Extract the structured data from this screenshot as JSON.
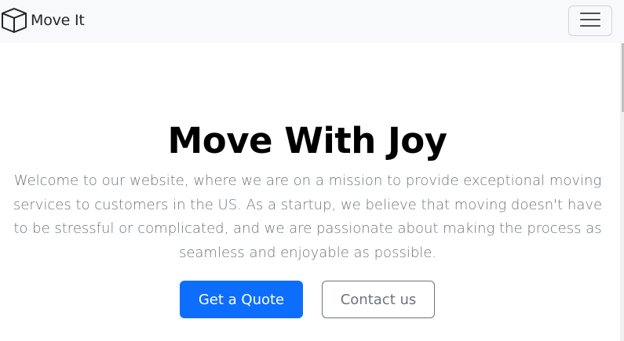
{
  "navbar": {
    "brand_name": "Move It",
    "brand_icon": "box-icon",
    "toggler_icon": "hamburger-menu-icon"
  },
  "hero": {
    "title": "Move With Joy",
    "description": "Welcome to our website, where we are on a mission to provide exceptional moving services to customers in the US. As a startup, we believe that moving doesn't have to be stressful or complicated, and we are passionate about making the process as seamless and enjoyable as possible.",
    "primary_button": "Get a Quote",
    "secondary_button": "Contact us"
  },
  "colors": {
    "navbar_bg": "#f8f9fa",
    "primary": "#0d6efd",
    "secondary_text": "#6c757d"
  }
}
